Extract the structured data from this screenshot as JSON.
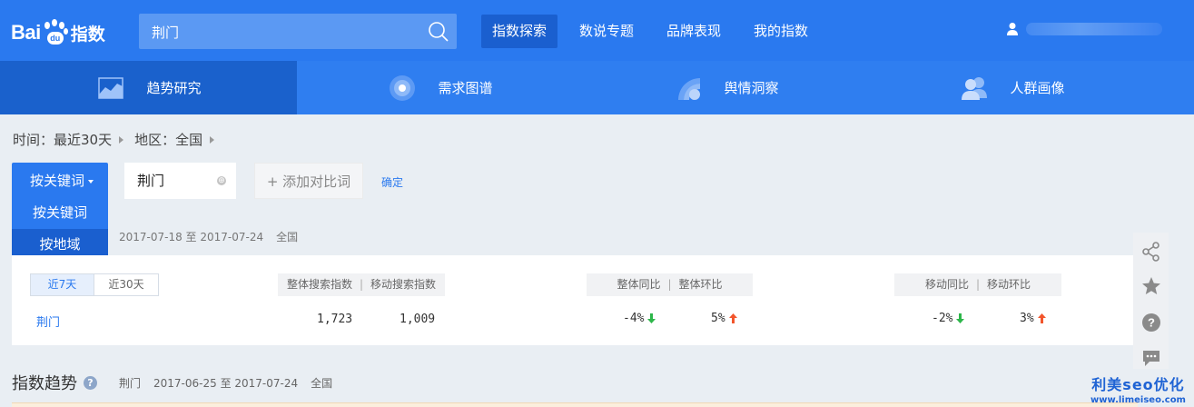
{
  "header": {
    "logo": {
      "bai": "Bai",
      "du": "du",
      "zhishu": "指数"
    },
    "search": {
      "value": "荆门"
    },
    "nav": [
      "指数探索",
      "数说专题",
      "品牌表现",
      "我的指数"
    ],
    "nav_active": 0
  },
  "subnav": {
    "tabs": [
      {
        "label": "趋势研究",
        "icon": "trend-chart-icon"
      },
      {
        "label": "需求图谱",
        "icon": "demand-graph-icon"
      },
      {
        "label": "舆情洞察",
        "icon": "sentiment-icon"
      },
      {
        "label": "人群画像",
        "icon": "people-icon"
      }
    ]
  },
  "filters": {
    "time": "时间：最近30天",
    "region": "地区：全国"
  },
  "keyword_bar": {
    "mode_button": "按关键词",
    "mode_options": [
      "按关键词",
      "按地域"
    ],
    "keyword": "荆门",
    "add_compare": "+ 添加对比词",
    "confirm": "确定"
  },
  "dateline": {
    "range": "2017-07-18 至 2017-07-24",
    "region": "全国"
  },
  "card": {
    "ranges": [
      "近7天",
      "近30天"
    ],
    "headers": {
      "search": [
        "整体搜索指数",
        "移动搜索指数"
      ],
      "overall_change": [
        "整体同比",
        "整体环比"
      ],
      "mobile_change": [
        "移动同比",
        "移动环比"
      ]
    },
    "row": {
      "keyword": "荆门",
      "overall_index": "1,723",
      "mobile_index": "1,009",
      "overall_yoy": "-4%",
      "overall_mom": "5%",
      "mobile_yoy": "-2%",
      "mobile_mom": "3%"
    },
    "colors": {
      "down": "#2db64a",
      "up": "#f2552c"
    }
  },
  "trend": {
    "title": "指数趋势",
    "help": "?",
    "keyword": "荆门",
    "range": "2017-06-25 至 2017-07-24",
    "region": "全国"
  },
  "watermark": {
    "line1": "利美seo优化",
    "line2": "www.limeiseo.com"
  },
  "tools": [
    "share-icon",
    "star-icon",
    "help-icon",
    "comment-icon"
  ]
}
